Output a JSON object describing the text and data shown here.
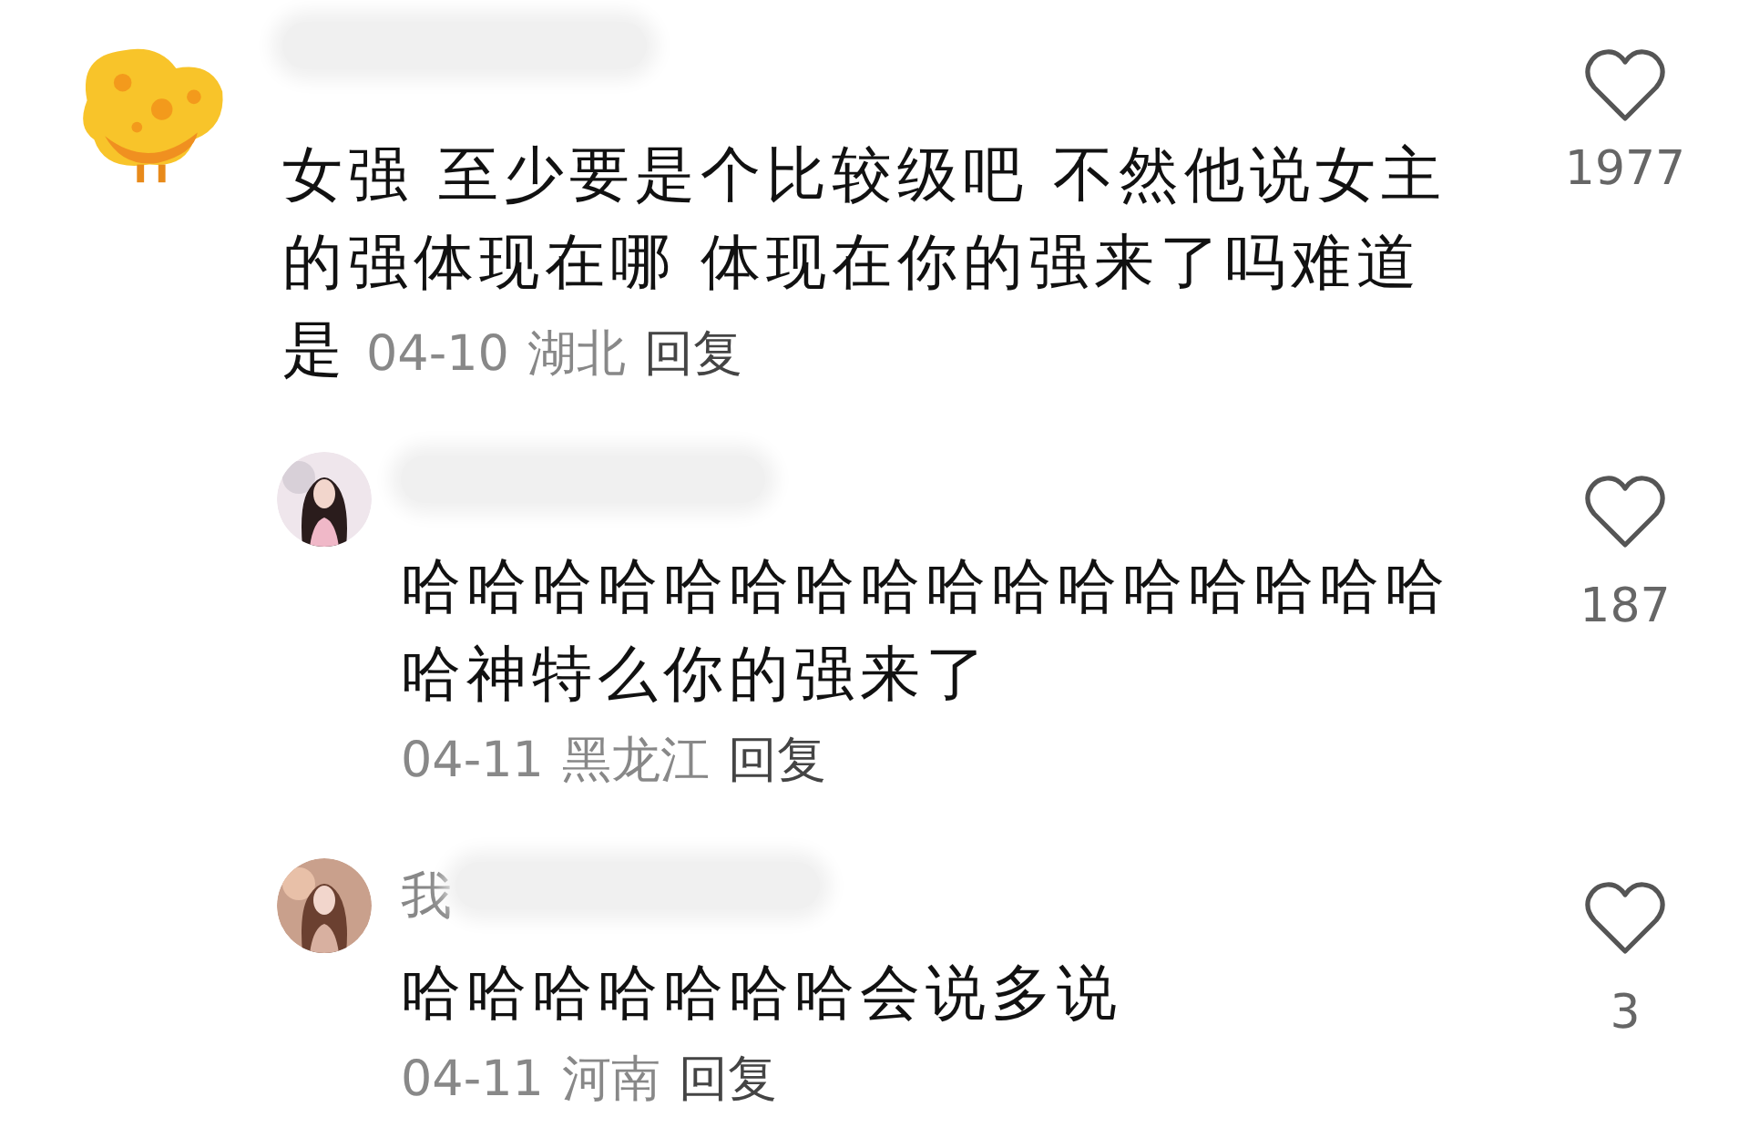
{
  "comments": [
    {
      "avatar": {
        "kind": "picture"
      },
      "name_blurred": true,
      "lines": [
        "女强 至少要是个比较级吧 不然他说女主",
        "的强体现在哪 体现在你的强来了吗难道",
        "是"
      ],
      "date": "04-10",
      "location": "湖北",
      "reply_label": "回复",
      "likes": "1977",
      "replies": [
        {
          "avatar": {
            "kind": "picture"
          },
          "name_blurred": true,
          "lines": [
            "哈哈哈哈哈哈哈哈哈哈哈哈哈哈哈哈",
            "哈神特么你的强来了"
          ],
          "date": "04-11",
          "location": "黑龙江",
          "reply_label": "回复",
          "likes": "187"
        },
        {
          "avatar": {
            "kind": "picture"
          },
          "username": "我",
          "name_blurred": true,
          "lines": [
            "哈哈哈哈哈哈哈会说多说"
          ],
          "date": "04-11",
          "location": "河南",
          "reply_label": "回复",
          "likes": "3"
        }
      ]
    }
  ]
}
